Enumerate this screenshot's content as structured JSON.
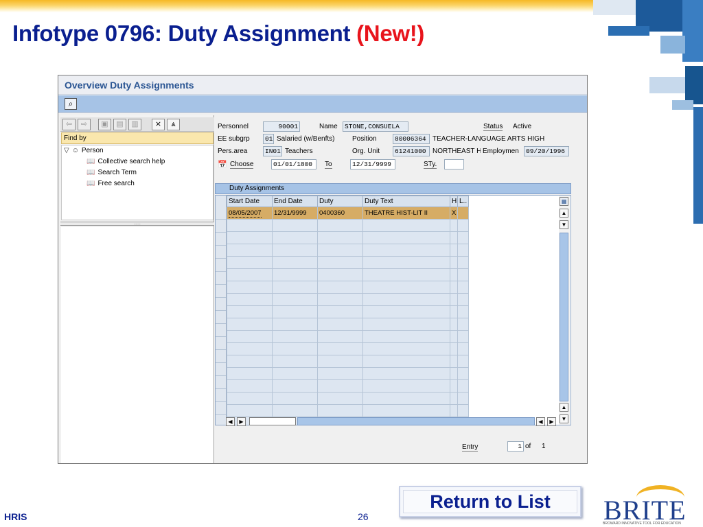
{
  "slide": {
    "title": "Infotype 0796: Duty Assignment",
    "title_highlight": "(New!)",
    "footer_left": "HRIS",
    "page_number": "26",
    "return_button": "Return to List",
    "logo_text": "BRITE",
    "logo_subtitle": "BROWARD INNOVATIVE TOOL FOR EDUCATION",
    "colors": {
      "title": "#0a1f8f",
      "highlight": "#e8141c",
      "accent_band": "#f6b825"
    }
  },
  "sap": {
    "window_title": "Overview Duty Assignments",
    "toolbar": {
      "find_icon": "find-icon"
    },
    "nav": {
      "find_by": "Find by",
      "tree": {
        "root": "Person",
        "children": [
          "Collective search help",
          "Search Term",
          "Free search"
        ]
      },
      "divider": "....."
    },
    "header": {
      "personnel_label": "Personnel",
      "personnel_value": "90001",
      "name_label": "Name",
      "name_value": "STONE,CONSUELA",
      "status_label": "Status",
      "status_value": "Active",
      "ee_subgrp_label": "EE subgrp",
      "ee_subgrp_value": "01",
      "ee_subgrp_text": "Salaried (w/Benfts)",
      "position_label": "Position",
      "position_value": "80006364",
      "position_text": "TEACHER-LANGUAGE ARTS HIGH",
      "pers_area_label": "Pers.area",
      "pers_area_value": "IN01",
      "pers_area_text": "Teachers",
      "org_unit_label": "Org. Unit",
      "org_unit_value": "61241000",
      "org_unit_text": "NORTHEAST H",
      "employment_label": "Employmen",
      "employment_value": "09/20/1996",
      "choose_label": "Choose",
      "choose_from": "01/01/1800",
      "to_label": "To",
      "choose_to": "12/31/9999",
      "sty_label": "STy.",
      "sty_value": ""
    },
    "table": {
      "title": "Duty Assignments",
      "columns": [
        "Start Date",
        "End Date",
        "Duty",
        "Duty Text",
        "H",
        "L.."
      ],
      "rows": [
        [
          "08/05/2007",
          "12/31/9999",
          "0400360",
          "THEATRE HIST-LIT II",
          "X",
          ""
        ]
      ],
      "empty_rows": 17
    },
    "entry": {
      "label": "Entry",
      "value": "1",
      "of_label": "of",
      "total": "1"
    }
  }
}
